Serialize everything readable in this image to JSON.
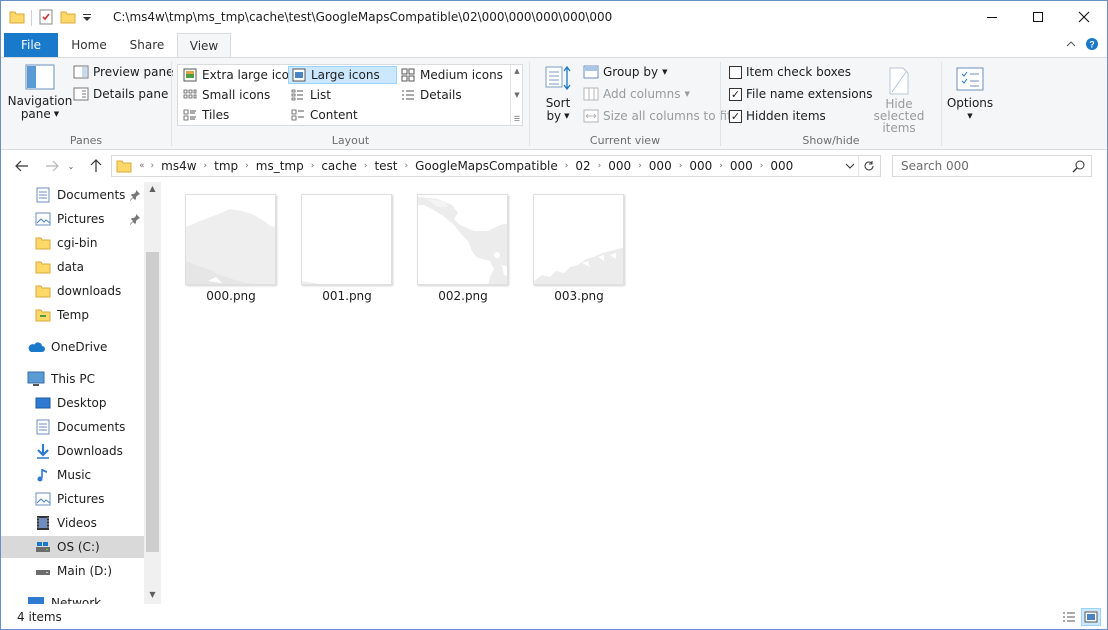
{
  "window": {
    "path": "C:\\ms4w\\tmp\\ms_tmp\\cache\\test\\GoogleMapsCompatible\\02\\000\\000\\000\\000\\000"
  },
  "tabs": {
    "file": "File",
    "home": "Home",
    "share": "Share",
    "view": "View"
  },
  "ribbon": {
    "panes": {
      "label": "Panes",
      "navigation_pane_line1": "Navigation",
      "navigation_pane_line2": "pane",
      "preview_pane": "Preview pane",
      "details_pane": "Details pane"
    },
    "layout": {
      "label": "Layout",
      "options": [
        "Extra large icons",
        "Large icons",
        "Medium icons",
        "Small icons",
        "List",
        "Details",
        "Tiles",
        "Content"
      ],
      "selected": "Large icons"
    },
    "current_view": {
      "label": "Current view",
      "sort_line1": "Sort",
      "sort_line2": "by",
      "group_by": "Group by",
      "add_columns": "Add columns",
      "size_all_columns": "Size all columns to fit"
    },
    "show_hide": {
      "label": "Show/hide",
      "item_check_boxes": "Item check boxes",
      "item_check_boxes_checked": false,
      "file_name_extensions": "File name extensions",
      "file_name_extensions_checked": true,
      "hidden_items": "Hidden items",
      "hidden_items_checked": true,
      "hide_selected_line1": "Hide selected",
      "hide_selected_line2": "items"
    },
    "options": {
      "label": "Options"
    }
  },
  "address": {
    "overflow": "«",
    "crumbs": [
      "ms4w",
      "tmp",
      "ms_tmp",
      "cache",
      "test",
      "GoogleMapsCompatible",
      "02",
      "000",
      "000",
      "000",
      "000",
      "000"
    ],
    "search_placeholder": "Search 000"
  },
  "nav": {
    "quick_access": [
      {
        "label": "Documents",
        "icon": "documents-icon",
        "pinned": true
      },
      {
        "label": "Pictures",
        "icon": "pictures-icon",
        "pinned": true
      },
      {
        "label": "cgi-bin",
        "icon": "folder-icon",
        "pinned": false
      },
      {
        "label": "data",
        "icon": "folder-icon",
        "pinned": false
      },
      {
        "label": "downloads",
        "icon": "folder-icon",
        "pinned": false
      },
      {
        "label": "Temp",
        "icon": "folder-icon",
        "pinned": false
      }
    ],
    "onedrive": "OneDrive",
    "this_pc": "This PC",
    "this_pc_items": [
      {
        "label": "Desktop",
        "icon": "desktop-icon"
      },
      {
        "label": "Documents",
        "icon": "documents-icon"
      },
      {
        "label": "Downloads",
        "icon": "downloads-icon"
      },
      {
        "label": "Music",
        "icon": "music-icon"
      },
      {
        "label": "Pictures",
        "icon": "pictures-icon"
      },
      {
        "label": "Videos",
        "icon": "videos-icon"
      },
      {
        "label": "OS (C:)",
        "icon": "drive-icon",
        "selected": true
      },
      {
        "label": "Main (D:)",
        "icon": "drive-icon"
      }
    ],
    "network": "Network"
  },
  "files": [
    {
      "name": "000.png"
    },
    {
      "name": "001.png"
    },
    {
      "name": "002.png"
    },
    {
      "name": "003.png"
    }
  ],
  "status": {
    "count": "4 items"
  },
  "colors": {
    "accent": "#1979ca",
    "folder": "#ffd86a",
    "selection": "#cce8ff"
  }
}
